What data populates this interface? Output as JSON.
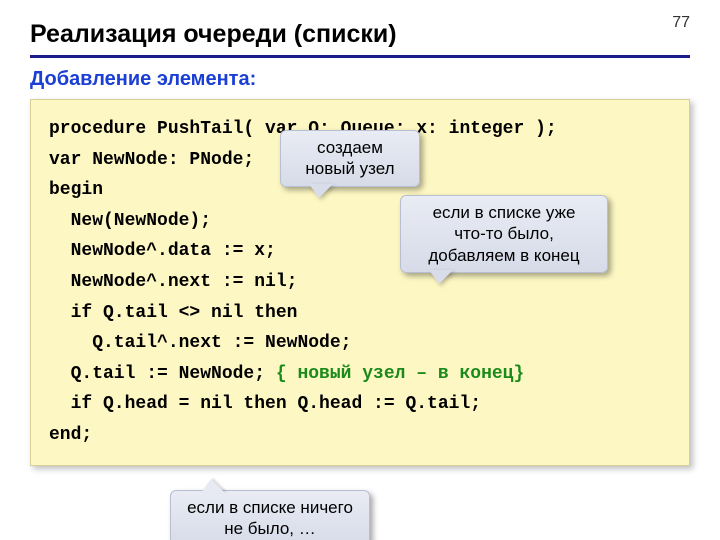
{
  "page_number": "77",
  "title": "Реализация очереди (списки)",
  "subtitle": "Добавление элемента:",
  "code": {
    "l1": "procedure PushTail( var Q: Queue; x: integer );",
    "l2": "var NewNode: PNode;",
    "l3": "begin",
    "l4": "  New(NewNode);",
    "l5": "  NewNode^.data := x;",
    "l6": "  NewNode^.next := nil;",
    "l7": "  if Q.tail <> nil then",
    "l8": "    Q.tail^.next := NewNode;",
    "l9a": "  Q.tail := NewNode; ",
    "l9b": "{ новый узел – в конец}",
    "l10": "  if Q.head = nil then Q.head := Q.tail;",
    "l11": "end;"
  },
  "callouts": {
    "c1": "создаем новый узел",
    "c2": "если в списке уже что-то было, добавляем в конец",
    "c3": "если в списке ничего не было, …"
  }
}
